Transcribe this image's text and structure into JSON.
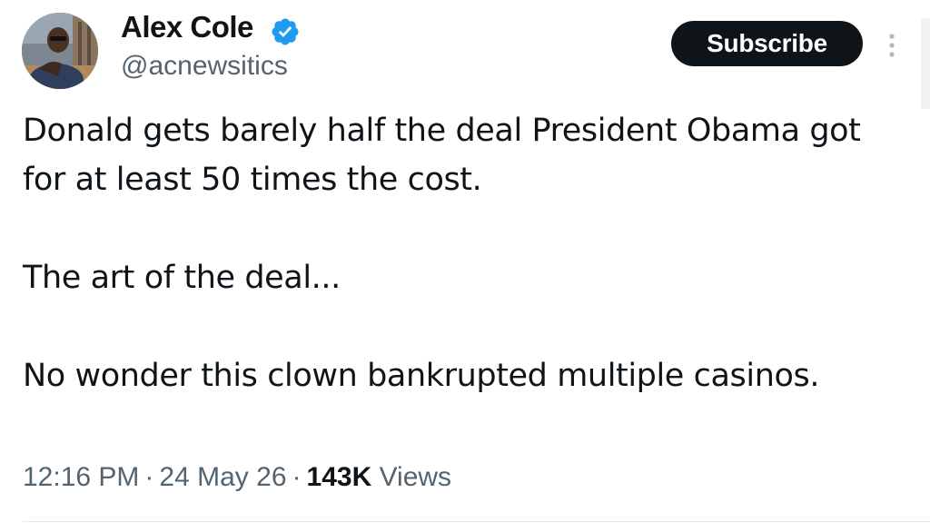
{
  "author": {
    "name": "Alex Cole",
    "handle": "@acnewsitics",
    "verified": true,
    "avatar_icon": "profile-photo"
  },
  "actions": {
    "subscribe_label": "Subscribe",
    "more_icon": "more-vertical-icon"
  },
  "tweet": {
    "paragraphs": [
      "Donald gets barely half the deal President Obama got for at least 50 times the cost.",
      "The art of the deal...",
      "No wonder this clown bankrupted multiple casinos."
    ]
  },
  "meta": {
    "time": "12:16 PM",
    "separator": "·",
    "date": "24 May 26",
    "views_count": "143K",
    "views_label": "Views"
  },
  "colors": {
    "text_primary": "#0f1419",
    "text_secondary": "#536471",
    "verified_blue": "#1d9bf0",
    "button_bg": "#0f1419"
  }
}
